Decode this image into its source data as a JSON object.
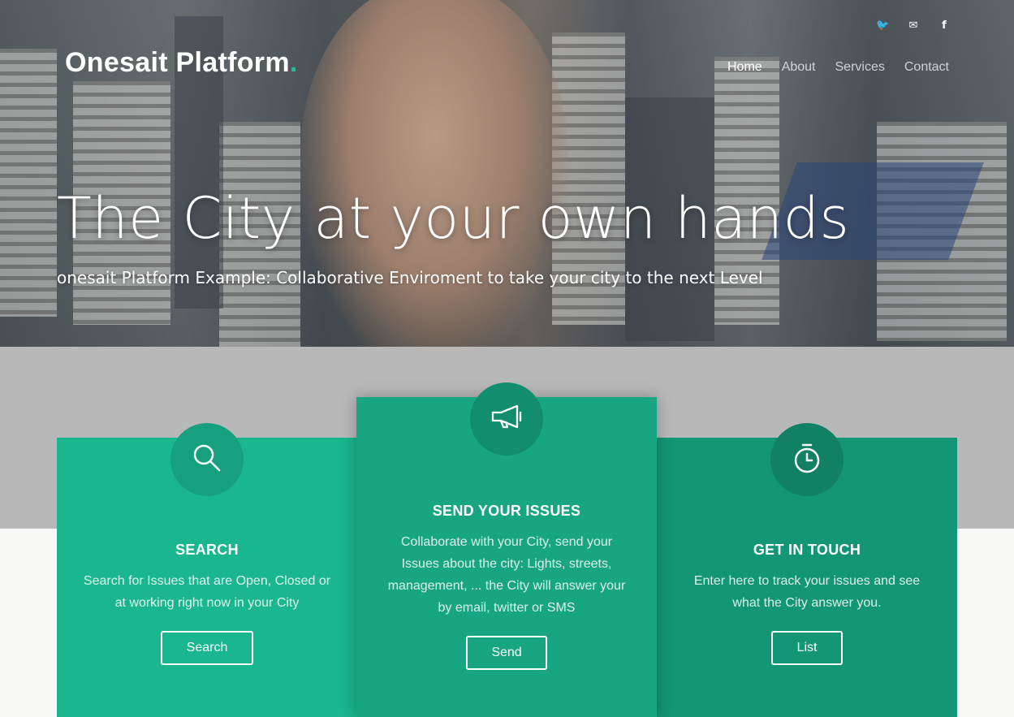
{
  "brand": {
    "name": "Onesait Platform",
    "dot": ".",
    "accent_color": "#1bc49a"
  },
  "social": [
    {
      "icon": "twitter-icon",
      "glyph": "🐦"
    },
    {
      "icon": "mail-icon",
      "glyph": "✉"
    },
    {
      "icon": "facebook-icon",
      "glyph": "f"
    }
  ],
  "nav": {
    "items": [
      {
        "label": "Home",
        "active": true
      },
      {
        "label": "About",
        "active": false
      },
      {
        "label": "Services",
        "active": false
      },
      {
        "label": "Contact",
        "active": false
      }
    ]
  },
  "hero": {
    "headline": "The City at your own hands",
    "subline": "onesait Platform Example: Collaborative Enviroment to take your city to the next Level"
  },
  "cards": {
    "search": {
      "icon": "magnifier-icon",
      "title": "SEARCH",
      "text": "Search for Issues that are Open, Closed or at working right now in your City",
      "button": "Search",
      "color": "#19b68f"
    },
    "send": {
      "icon": "megaphone-icon",
      "title": "SEND YOUR ISSUES",
      "text": "Collaborate with your City, send your Issues about the city: Lights, streets, management, ... the City will answer your by email, twitter or SMS",
      "button": "Send",
      "color": "#17a582"
    },
    "touch": {
      "icon": "stopwatch-icon",
      "title": "GET IN TOUCH",
      "text": "Enter here to track your issues and see what the City answer you.",
      "button": "List",
      "color": "#139675"
    }
  }
}
